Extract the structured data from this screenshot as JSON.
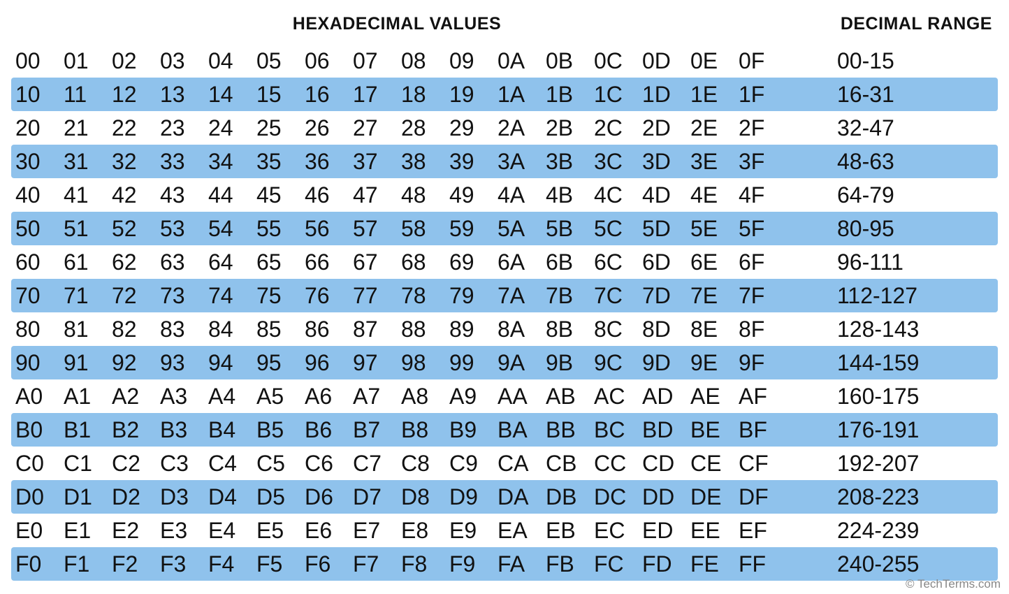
{
  "header": {
    "hex_title": "HEXADECIMAL VALUES",
    "dec_title": "DECIMAL RANGE"
  },
  "rows": [
    {
      "hex": [
        "00",
        "01",
        "02",
        "03",
        "04",
        "05",
        "06",
        "07",
        "08",
        "09",
        "0A",
        "0B",
        "0C",
        "0D",
        "0E",
        "0F"
      ],
      "range": "00-15",
      "alt": false
    },
    {
      "hex": [
        "10",
        "11",
        "12",
        "13",
        "14",
        "15",
        "16",
        "17",
        "18",
        "19",
        "1A",
        "1B",
        "1C",
        "1D",
        "1E",
        "1F"
      ],
      "range": "16-31",
      "alt": true
    },
    {
      "hex": [
        "20",
        "21",
        "22",
        "23",
        "24",
        "25",
        "26",
        "27",
        "28",
        "29",
        "2A",
        "2B",
        "2C",
        "2D",
        "2E",
        "2F"
      ],
      "range": "32-47",
      "alt": false
    },
    {
      "hex": [
        "30",
        "31",
        "32",
        "33",
        "34",
        "35",
        "36",
        "37",
        "38",
        "39",
        "3A",
        "3B",
        "3C",
        "3D",
        "3E",
        "3F"
      ],
      "range": "48-63",
      "alt": true
    },
    {
      "hex": [
        "40",
        "41",
        "42",
        "43",
        "44",
        "45",
        "46",
        "47",
        "48",
        "49",
        "4A",
        "4B",
        "4C",
        "4D",
        "4E",
        "4F"
      ],
      "range": "64-79",
      "alt": false
    },
    {
      "hex": [
        "50",
        "51",
        "52",
        "53",
        "54",
        "55",
        "56",
        "57",
        "58",
        "59",
        "5A",
        "5B",
        "5C",
        "5D",
        "5E",
        "5F"
      ],
      "range": "80-95",
      "alt": true
    },
    {
      "hex": [
        "60",
        "61",
        "62",
        "63",
        "64",
        "65",
        "66",
        "67",
        "68",
        "69",
        "6A",
        "6B",
        "6C",
        "6D",
        "6E",
        "6F"
      ],
      "range": "96-111",
      "alt": false
    },
    {
      "hex": [
        "70",
        "71",
        "72",
        "73",
        "74",
        "75",
        "76",
        "77",
        "78",
        "79",
        "7A",
        "7B",
        "7C",
        "7D",
        "7E",
        "7F"
      ],
      "range": "112-127",
      "alt": true
    },
    {
      "hex": [
        "80",
        "81",
        "82",
        "83",
        "84",
        "85",
        "86",
        "87",
        "88",
        "89",
        "8A",
        "8B",
        "8C",
        "8D",
        "8E",
        "8F"
      ],
      "range": "128-143",
      "alt": false
    },
    {
      "hex": [
        "90",
        "91",
        "92",
        "93",
        "94",
        "95",
        "96",
        "97",
        "98",
        "99",
        "9A",
        "9B",
        "9C",
        "9D",
        "9E",
        "9F"
      ],
      "range": "144-159",
      "alt": true
    },
    {
      "hex": [
        "A0",
        "A1",
        "A2",
        "A3",
        "A4",
        "A5",
        "A6",
        "A7",
        "A8",
        "A9",
        "AA",
        "AB",
        "AC",
        "AD",
        "AE",
        "AF"
      ],
      "range": "160-175",
      "alt": false
    },
    {
      "hex": [
        "B0",
        "B1",
        "B2",
        "B3",
        "B4",
        "B5",
        "B6",
        "B7",
        "B8",
        "B9",
        "BA",
        "BB",
        "BC",
        "BD",
        "BE",
        "BF"
      ],
      "range": "176-191",
      "alt": true
    },
    {
      "hex": [
        "C0",
        "C1",
        "C2",
        "C3",
        "C4",
        "C5",
        "C6",
        "C7",
        "C8",
        "C9",
        "CA",
        "CB",
        "CC",
        "CD",
        "CE",
        "CF"
      ],
      "range": "192-207",
      "alt": false
    },
    {
      "hex": [
        "D0",
        "D1",
        "D2",
        "D3",
        "D4",
        "D5",
        "D6",
        "D7",
        "D8",
        "D9",
        "DA",
        "DB",
        "DC",
        "DD",
        "DE",
        "DF"
      ],
      "range": "208-223",
      "alt": true
    },
    {
      "hex": [
        "E0",
        "E1",
        "E2",
        "E3",
        "E4",
        "E5",
        "E6",
        "E7",
        "E8",
        "E9",
        "EA",
        "EB",
        "EC",
        "ED",
        "EE",
        "EF"
      ],
      "range": "224-239",
      "alt": false
    },
    {
      "hex": [
        "F0",
        "F1",
        "F2",
        "F3",
        "F4",
        "F5",
        "F6",
        "F7",
        "F8",
        "F9",
        "FA",
        "FB",
        "FC",
        "FD",
        "FE",
        "FF"
      ],
      "range": "240-255",
      "alt": true
    }
  ],
  "watermark": "© TechTerms.com"
}
